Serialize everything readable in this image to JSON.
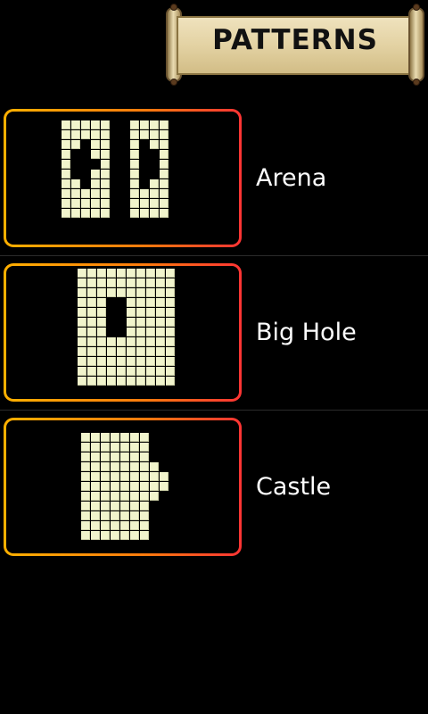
{
  "header": {
    "title": "PATTERNS"
  },
  "patterns": [
    {
      "label": "Arena",
      "rows": [
        "11111001111",
        "11111001111",
        "11011001011",
        "10011001001",
        "10001001001",
        "10011001001",
        "11011001011",
        "11111001111",
        "11111001111",
        "11111001111"
      ]
    },
    {
      "label": "Big Hole",
      "rows": [
        "1111111111",
        "1111111111",
        "1111111111",
        "1110011111",
        "1110011111",
        "1110011111",
        "1110011111",
        "1111111111",
        "1111111111",
        "1111111111",
        "1111111111",
        "1111111111"
      ]
    },
    {
      "label": "Castle",
      "rows": [
        "000000000",
        "11111110",
        "11111110",
        "11111110",
        "111111110",
        "111111111",
        "111111111",
        "111111110",
        "11111110",
        "11111110",
        "11111110",
        "11111110"
      ]
    }
  ]
}
